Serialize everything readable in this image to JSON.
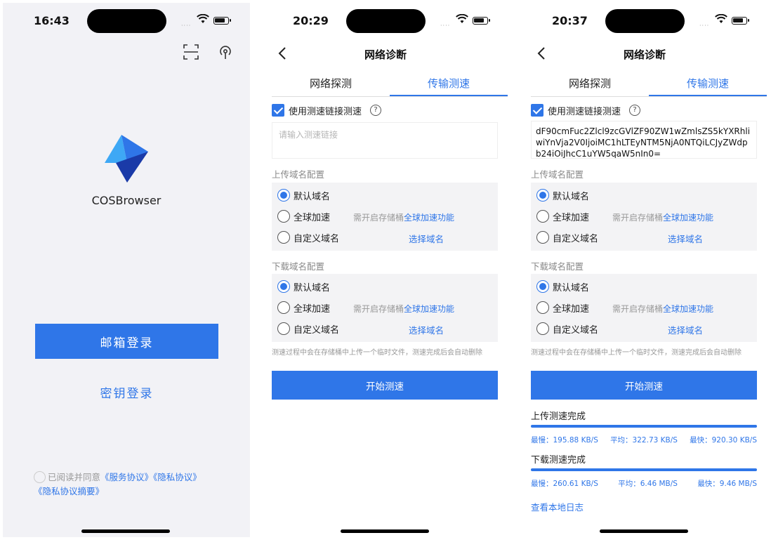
{
  "login": {
    "time": "16:43",
    "app_name": "COSBrowser",
    "email_login": "邮箱登录",
    "key_login": "密钥登录",
    "agree_prefix": "已阅读并同意",
    "service_agreement": "《服务协议》",
    "privacy_policy": "《隐私协议》",
    "privacy_summary": "《隐私协议摘要》"
  },
  "diag_empty": {
    "time": "20:29",
    "title": "网络诊断",
    "tabs": [
      "网络探测",
      "传输测速"
    ],
    "use_link_label": "使用测速链接测速",
    "link_placeholder": "请输入测速链接",
    "upload_section": "上传域名配置",
    "download_section": "下载域名配置",
    "options": [
      "默认域名",
      "全球加速",
      "自定义域名"
    ],
    "accel_note_prefix": "需开启存储桶",
    "accel_note_link": "全球加速功能",
    "choose_domain": "选择域名",
    "tip": "测速过程中会在存储桶中上传一个临时文件，测速完成后会自动删除",
    "start_button": "开始测速"
  },
  "diag_result": {
    "time": "20:37",
    "title": "网络诊断",
    "tabs": [
      "网络探测",
      "传输测速"
    ],
    "use_link_label": "使用测速链接测速",
    "link_value": "dF90cmFuc2Zlcl9zcGVlZF90ZW1wZmlsZS5kYXRhliwiYnVja2V0IjoiMC1hLTEyNTM5NjA0NTQiLCJyZWdpb24iOiJhcC1uYW5qaW5nIn0=",
    "upload_section": "上传域名配置",
    "download_section": "下载域名配置",
    "options": [
      "默认域名",
      "全球加速",
      "自定义域名"
    ],
    "accel_note_prefix": "需开启存储桶",
    "accel_note_link": "全球加速功能",
    "choose_domain": "选择域名",
    "tip": "测速过程中会在存储桶中上传一个临时文件，测速完成后会自动删除",
    "start_button": "开始测速",
    "upload_done": "上传测速完成",
    "upload_stats": [
      "最慢：195.88 KB/S",
      "平均：322.73 KB/S",
      "最快：920.30 KB/S"
    ],
    "download_done": "下载测速完成",
    "download_stats": [
      "最慢：260.61 KB/S",
      "平均：6.46 MB/S",
      "最快：9.46 MB/S"
    ],
    "view_log": "查看本地日志",
    "upload_progress": 1.0,
    "download_progress": 1.0
  },
  "colors": {
    "accent": "#2f76e8",
    "muted": "#999999",
    "panel": "#f3f3f5"
  }
}
